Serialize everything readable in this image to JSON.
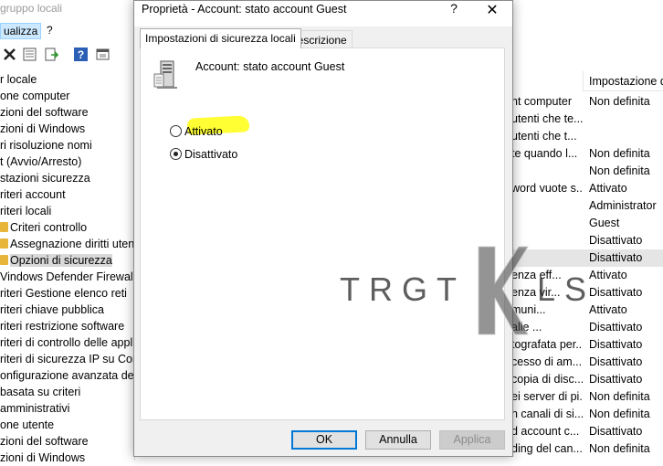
{
  "background_window": {
    "title": "gruppo locali",
    "menu": [
      {
        "label": "ualizza"
      },
      {
        "label": "?"
      }
    ],
    "toolbar_icons": [
      "delete-icon",
      "properties-icon",
      "export-icon",
      "help-icon",
      "show-pane-icon"
    ],
    "tree": [
      {
        "label": "r locale"
      },
      {
        "label": "one computer"
      },
      {
        "label": "zioni del software"
      },
      {
        "label": "zioni di Windows"
      },
      {
        "label": "ri risoluzione nomi"
      },
      {
        "label": "t (Avvio/Arresto)"
      },
      {
        "label": "stazioni sicurezza"
      },
      {
        "label": "riteri account"
      },
      {
        "label": "riteri locali"
      },
      {
        "label": "Criteri controllo",
        "icon": "folder-lock-icon"
      },
      {
        "label": "Assegnazione diritti utente",
        "icon": "folder-lock-icon"
      },
      {
        "label": "Opzioni di sicurezza",
        "icon": "folder-lock-icon",
        "selected": true
      },
      {
        "label": "Vindows Defender Firewall con"
      },
      {
        "label": "riteri Gestione elenco reti"
      },
      {
        "label": "riteri chiave pubblica"
      },
      {
        "label": "riteri restrizione software"
      },
      {
        "label": "riteri di controllo delle appli"
      },
      {
        "label": "riteri di sicurezza IP su Comp"
      },
      {
        "label": "onfigurazione avanzata dei c"
      },
      {
        "label": "basata su criteri"
      },
      {
        "label": "amministrativi"
      },
      {
        "label": "one utente"
      },
      {
        "label": "zioni del software"
      },
      {
        "label": "zioni di Windows"
      }
    ],
    "column_header": "Impostazione di",
    "rows": [
      {
        "c1": "nt computer",
        "c2": "Non definita"
      },
      {
        "c1": "utenti che te...",
        "c2": ""
      },
      {
        "c1": "utenti che t...",
        "c2": ""
      },
      {
        "c1": "te quando l...",
        "c2": "Non definita"
      },
      {
        "c1": "",
        "c2": "Non definita"
      },
      {
        "c1": "word vuote s...",
        "c2": "Attivato"
      },
      {
        "c1": "",
        "c2": "Administrator"
      },
      {
        "c1": "",
        "c2": "Guest"
      },
      {
        "c1": "",
        "c2": "Disattivato"
      },
      {
        "c1": "",
        "c2": "Disattivato",
        "selected": true
      },
      {
        "c1": "enza eff...",
        "c2": "Attivato"
      },
      {
        "c1": "enza vir...",
        "c2": "Disattivato"
      },
      {
        "c1": "muni...",
        "c2": "Attivato"
      },
      {
        "c1": "alle ...",
        "c2": "Disattivato"
      },
      {
        "c1": "tografata per...",
        "c2": "Disattivato"
      },
      {
        "c1": "cesso di am...",
        "c2": "Disattivato"
      },
      {
        "c1": "copia di disc...",
        "c2": "Disattivato"
      },
      {
        "c1": "ei server di pi...",
        "c2": "Non definita"
      },
      {
        "c1": "n canali di si...",
        "c2": "Non definita"
      },
      {
        "c1": "d account c...",
        "c2": "Disattivato"
      },
      {
        "c1": "ding del can...",
        "c2": "Non definita"
      }
    ]
  },
  "watermark": {
    "left": "TRGT",
    "right": "LS"
  },
  "dialog": {
    "title": "Proprietà - Account: stato account Guest",
    "help_label": "?",
    "close_label": "✕",
    "tabs": [
      {
        "label": "Impostazioni di sicurezza locali",
        "active": true
      },
      {
        "label": "Descrizione",
        "active": false
      }
    ],
    "policy_name": "Account: stato account Guest",
    "options": [
      {
        "label": "Attivato",
        "checked": false
      },
      {
        "label": "Disattivato",
        "checked": true
      }
    ],
    "buttons": {
      "ok": "OK",
      "cancel": "Annulla",
      "apply": "Applica"
    },
    "highlight_color": "#ffff33"
  }
}
